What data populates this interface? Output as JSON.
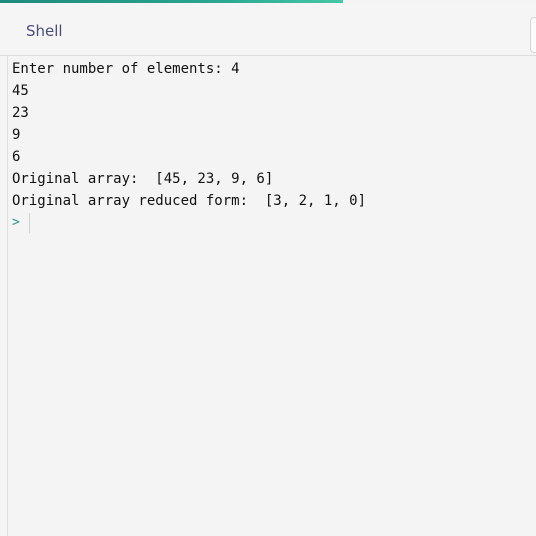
{
  "header": {
    "title": "Shell"
  },
  "console": {
    "lines": [
      "Enter number of elements: 4",
      "45",
      "23",
      "9",
      "6",
      "Original array:  [45, 23, 9, 6]",
      "Original array reduced form:  [3, 2, 1, 0]"
    ],
    "prompt": ">"
  },
  "colors": {
    "accent": "#2b9a86",
    "title_text": "#4b4f78",
    "background": "#f4f4f4"
  }
}
